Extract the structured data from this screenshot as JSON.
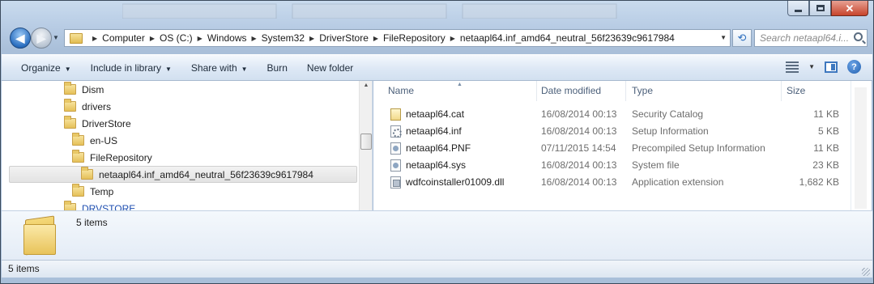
{
  "window": {
    "caption_buttons": {
      "minimize": "minimize",
      "maximize": "maximize",
      "close": "✕"
    }
  },
  "nav": {
    "back_glyph": "◀",
    "forward_glyph": "▶",
    "recent_glyph": "▼",
    "breadcrumbs": [
      "Computer",
      "OS (C:)",
      "Windows",
      "System32",
      "DriverStore",
      "FileRepository",
      "netaapl64.inf_amd64_neutral_56f23639c9617984"
    ],
    "dropdown_glyph": "▼",
    "refresh_glyph": "⟲",
    "search_placeholder": "Search netaapl64.i..."
  },
  "toolbar": {
    "organize": "Organize",
    "include_in_library": "Include in library",
    "share_with": "Share with",
    "burn": "Burn",
    "new_folder": "New folder",
    "caret": "▼",
    "help": "?"
  },
  "tree": {
    "items": [
      {
        "label": "Dism",
        "selected": false
      },
      {
        "label": "drivers",
        "selected": false
      },
      {
        "label": "DriverStore",
        "selected": false
      },
      {
        "label": "en-US",
        "selected": false
      },
      {
        "label": "FileRepository",
        "selected": false
      },
      {
        "label": "netaapl64.inf_amd64_neutral_56f23639c9617984",
        "selected": true
      },
      {
        "label": "Temp",
        "selected": false
      },
      {
        "label": "DRVSTORE",
        "selected": false
      }
    ]
  },
  "columns": {
    "name": "Name",
    "date_modified": "Date modified",
    "type": "Type",
    "size": "Size"
  },
  "files": [
    {
      "name": "netaapl64.cat",
      "date": "16/08/2014 00:13",
      "type": "Security Catalog",
      "size": "11 KB",
      "icon": "cat"
    },
    {
      "name": "netaapl64.inf",
      "date": "16/08/2014 00:13",
      "type": "Setup Information",
      "size": "5 KB",
      "icon": "inf"
    },
    {
      "name": "netaapl64.PNF",
      "date": "07/11/2015 14:54",
      "type": "Precompiled Setup Information",
      "size": "11 KB",
      "icon": "pnf"
    },
    {
      "name": "netaapl64.sys",
      "date": "16/08/2014 00:13",
      "type": "System file",
      "size": "23 KB",
      "icon": "sys"
    },
    {
      "name": "wdfcoinstaller01009.dll",
      "date": "16/08/2014 00:13",
      "type": "Application extension",
      "size": "1,682 KB",
      "icon": "dll"
    }
  ],
  "details": {
    "count": "5 items"
  },
  "status": {
    "count": "5 items"
  },
  "colors": {
    "link": "#1c4db0",
    "close": "#c7442c",
    "accent": "#2b6fc0"
  }
}
